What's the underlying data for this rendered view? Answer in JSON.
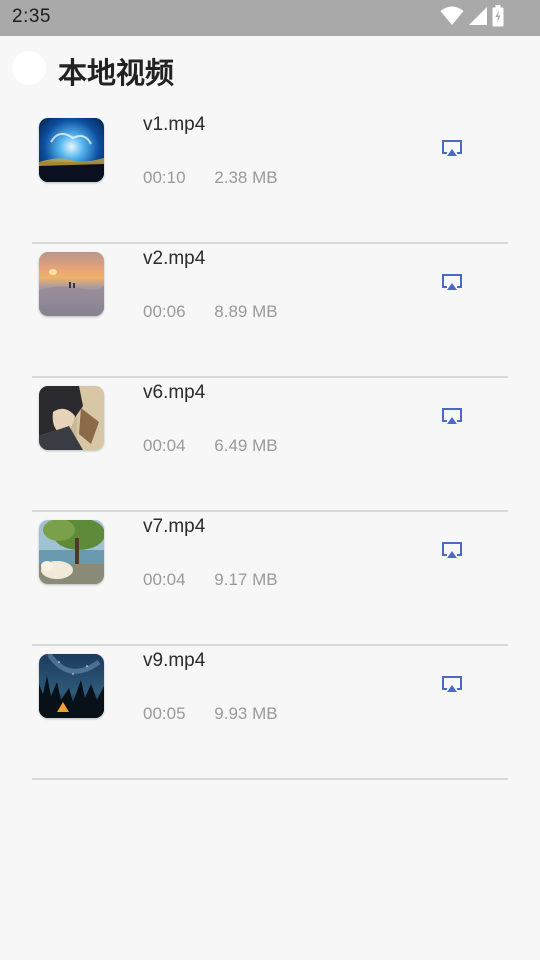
{
  "status_bar": {
    "time": "2:35",
    "icons": [
      "wifi-icon",
      "cell-signal-icon",
      "battery-icon"
    ]
  },
  "header": {
    "title": "本地视频"
  },
  "videos": [
    {
      "name": "v1.mp4",
      "duration": "00:10",
      "size": "2.38 MB",
      "thumbnail": "blue-light-tree-thumbnail"
    },
    {
      "name": "v2.mp4",
      "duration": "00:06",
      "size": "8.89 MB",
      "thumbnail": "sunset-clouds-thumbnail"
    },
    {
      "name": "v6.mp4",
      "duration": "00:04",
      "size": "6.49 MB",
      "thumbnail": "anime-character-thumbnail"
    },
    {
      "name": "v7.mp4",
      "duration": "00:04",
      "size": "9.17 MB",
      "thumbnail": "dog-under-tree-thumbnail"
    },
    {
      "name": "v9.mp4",
      "duration": "00:05",
      "size": "9.93 MB",
      "thumbnail": "night-sky-tent-thumbnail"
    }
  ],
  "colors": {
    "status_bar_bg": "#a9a9a9",
    "page_bg": "#f7f7f8",
    "cast_icon": "#4a6ac8",
    "meta_text": "#9a9a9a",
    "divider": "#d9d9d9"
  }
}
